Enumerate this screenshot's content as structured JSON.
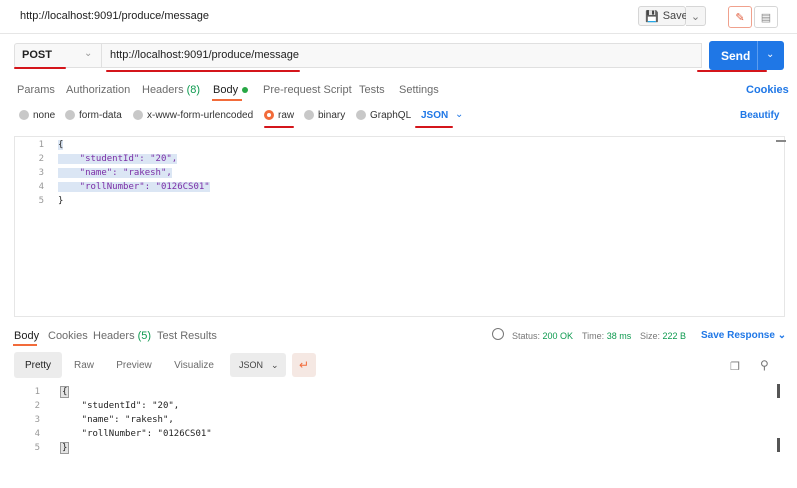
{
  "window_title": "http://localhost:9091/produce/message",
  "toolbar": {
    "save_label": "Save"
  },
  "request": {
    "method": "POST",
    "url": "http://localhost:9091/produce/message",
    "send_label": "Send"
  },
  "request_tabs": {
    "params": "Params",
    "authorization": "Authorization",
    "headers": "Headers",
    "headers_count": "(8)",
    "body": "Body",
    "pre_request": "Pre-request Script",
    "tests": "Tests",
    "settings": "Settings",
    "cookies": "Cookies"
  },
  "body_types": {
    "none": "none",
    "form_data": "form-data",
    "urlencoded": "x-www-form-urlencoded",
    "raw": "raw",
    "binary": "binary",
    "graphql": "GraphQL",
    "language": "JSON",
    "beautify": "Beautify"
  },
  "request_body": {
    "line_numbers": [
      "1",
      "2",
      "3",
      "4",
      "5"
    ],
    "lines": [
      "{",
      "    \"studentId\": \"20\",",
      "    \"name\": \"rakesh\",",
      "    \"rollNumber\": \"0126CS01\"",
      "}"
    ]
  },
  "response_tabs": {
    "body": "Body",
    "cookies": "Cookies",
    "headers": "Headers",
    "headers_count": "(5)",
    "test_results": "Test Results"
  },
  "response_status": {
    "status_label": "Status:",
    "status_value": "200 OK",
    "time_label": "Time:",
    "time_value": "38 ms",
    "size_label": "Size:",
    "size_value": "222 B",
    "save_response": "Save Response"
  },
  "response_formats": {
    "pretty": "Pretty",
    "raw": "Raw",
    "preview": "Preview",
    "visualize": "Visualize",
    "language": "JSON"
  },
  "response_body": {
    "line_numbers": [
      "1",
      "2",
      "3",
      "4",
      "5"
    ],
    "lines": [
      "{",
      "    \"studentId\": \"20\",",
      "    \"name\": \"rakesh\",",
      "    \"rollNumber\": \"0126CS01\"",
      "}"
    ]
  },
  "colors": {
    "accent": "#1f77e6",
    "tab_underline": "#f26b3a",
    "annotation": "#d4151b",
    "status_ok": "#0d9a4f"
  }
}
